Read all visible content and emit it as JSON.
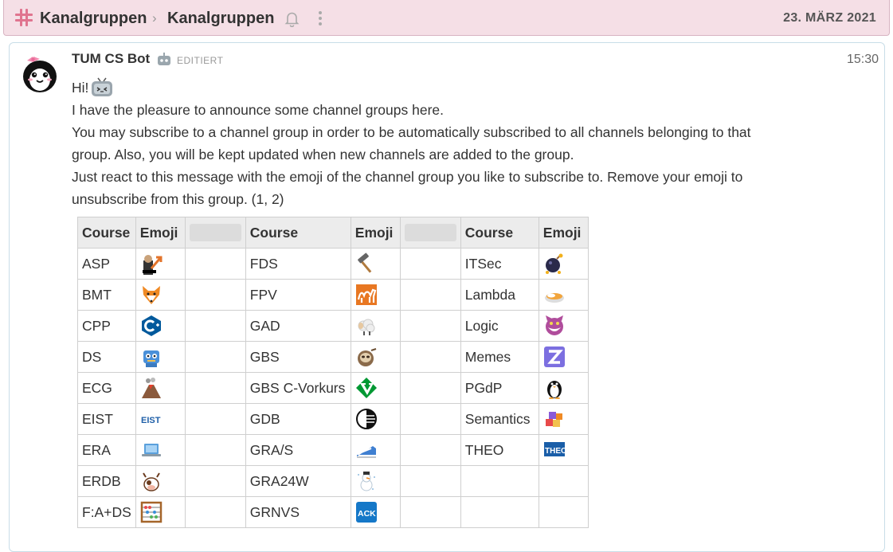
{
  "header": {
    "breadcrumb": [
      "Kanalgruppen",
      "Kanalgruppen"
    ],
    "date": "23. MÄRZ 2021",
    "colors": {
      "bar": "#f5dfe6",
      "hash": "#e0748f"
    }
  },
  "message": {
    "sender": "TUM CS Bot",
    "edited_label": "EDITIERT",
    "time": "15:30",
    "lines": [
      "Hi!",
      "I have the pleasure to announce some channel groups here.",
      "You may subscribe to a channel group in order to be automatically subscribed to all channels belonging to that group. Also, you will be kept updated when new channels are added to the group.",
      "Just react to this message with the emoji of the channel group you like to subscribe to. Remove your emoji to unsubscribe from this group. (1, 2)"
    ]
  },
  "table": {
    "headers": {
      "course": "Course",
      "emoji": "Emoji"
    },
    "columns": [
      [
        {
          "course": "ASP",
          "emoji": "stonks-icon"
        },
        {
          "course": "BMT",
          "emoji": "fox-icon"
        },
        {
          "course": "CPP",
          "emoji": "cpp-logo-icon"
        },
        {
          "course": "DS",
          "emoji": "robot-icon"
        },
        {
          "course": "ECG",
          "emoji": "volcano-icon"
        },
        {
          "course": "EIST",
          "emoji": "eist-logo-icon"
        },
        {
          "course": "ERA",
          "emoji": "laptop-icon"
        },
        {
          "course": "ERDB",
          "emoji": "cow-icon"
        },
        {
          "course": "F:A+DS",
          "emoji": "abacus-icon"
        }
      ],
      [
        {
          "course": "FDS",
          "emoji": "hammer-icon"
        },
        {
          "course": "FPV",
          "emoji": "camel-icon"
        },
        {
          "course": "GAD",
          "emoji": "sheep-icon"
        },
        {
          "course": "GBS",
          "emoji": "sloth-icon"
        },
        {
          "course": "GBS C-Vorkurs",
          "emoji": "vim-icon"
        },
        {
          "course": "GDB",
          "emoji": "database-icon"
        },
        {
          "course": "GRA/S",
          "emoji": "train-icon"
        },
        {
          "course": "GRA24W",
          "emoji": "snowman-icon"
        },
        {
          "course": "GRNVS",
          "emoji": "ack-icon"
        }
      ],
      [
        {
          "course": "ITSec",
          "emoji": "bomb-icon"
        },
        {
          "course": "Lambda",
          "emoji": "curry-icon"
        },
        {
          "course": "Logic",
          "emoji": "cheshire-cat-icon"
        },
        {
          "course": "Memes",
          "emoji": "z-icon"
        },
        {
          "course": "PGdP",
          "emoji": "penguin-icon"
        },
        {
          "course": "Semantics",
          "emoji": "blocks-icon"
        },
        {
          "course": "THEO",
          "emoji": "theo-icon"
        },
        {
          "course": "",
          "emoji": ""
        },
        {
          "course": "",
          "emoji": ""
        }
      ]
    ],
    "ack_text": "ACK"
  }
}
